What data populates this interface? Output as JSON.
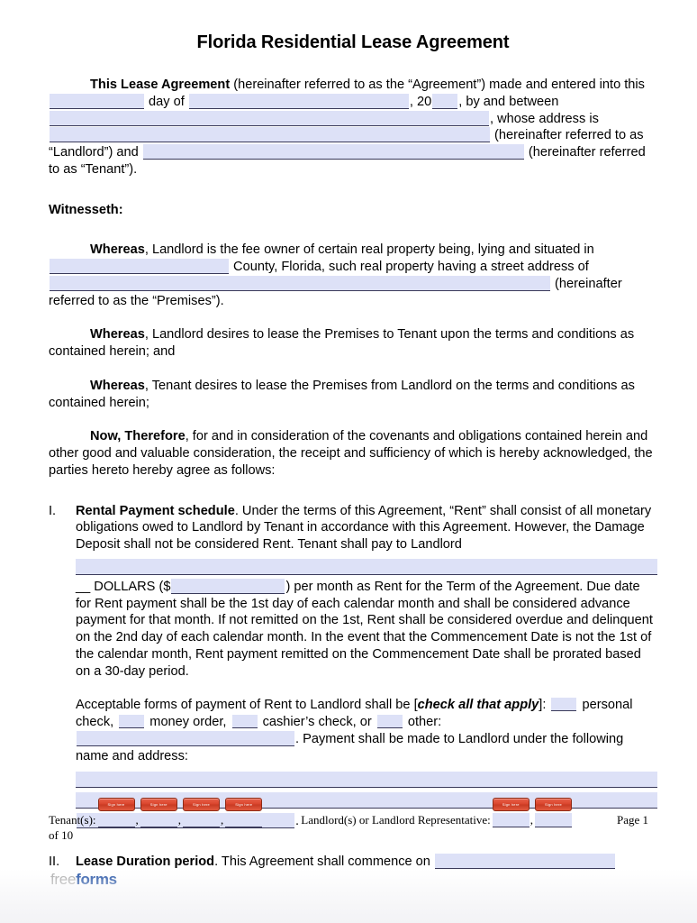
{
  "document": {
    "title": "Florida Residential Lease Agreement"
  },
  "intro": {
    "lead": "This Lease Agreement",
    "t1": " (hereinafter referred to as the “Agreement”) made and entered into this ",
    "t2": " day of ",
    "t3": ", 20",
    "t4": ", by and between ",
    "t5": ", whose address is ",
    "t6": " (hereinafter referred to as “Landlord”) and ",
    "t7": " (hereinafter referred to as “Tenant”)."
  },
  "witnesseth": {
    "heading": "Witnesseth:"
  },
  "whereas1": {
    "lead": "Whereas",
    "t1": ", Landlord is the fee owner of certain real property being, lying and situated in ",
    "t2": " County, Florida, such real property having a street address of ",
    "t3": " (hereinafter referred to as the “Premises”)."
  },
  "whereas2": {
    "lead": "Whereas",
    "t1": ", Landlord desires to lease the Premises to Tenant upon the terms and conditions as contained herein; and"
  },
  "whereas3": {
    "lead": "Whereas",
    "t1": ", Tenant desires to lease the Premises from Landlord on the terms and conditions as contained herein;"
  },
  "nowtherefore": {
    "lead": "Now, Therefore",
    "t1": ", for and in consideration of the covenants and obligations contained herein and other good and valuable consideration, the receipt and sufficiency of which is hereby acknowledged, the parties hereto hereby agree as follows:"
  },
  "section_one": {
    "numeral": "I.",
    "heading": "Rental Payment schedule",
    "t1": ".  Under the terms of this Agreement, “Rent” shall consist of all monetary obligations owed to Landlord by Tenant in accordance with this Agreement.  However, the Damage Deposit shall not be considered Rent.  Tenant shall pay to Landlord",
    "t2": "__ DOLLARS ($",
    "t3": ") per month as Rent for the Term of the Agreement. Due date for Rent payment shall be the 1st day of each calendar month and shall be considered advance payment for that month.  If not remitted on the 1st, Rent shall be considered overdue and delinquent on the 2nd day of each calendar month.  In the event that the Commencement Date is not the 1st of the calendar month, Rent payment remitted on the Commencement Date shall be prorated based on a 30-day period.",
    "payment_t1": "Acceptable forms of payment of Rent to Landlord shall be [",
    "payment_em": "check all that apply",
    "payment_t2": "]: ",
    "payment_t3": " personal check, ",
    "payment_t4": " money order, ",
    "payment_t5": " cashier’s check, or ",
    "payment_t6": " other: ",
    "payment_t7": ".  Payment shall be made to Landlord under the following name and address:",
    "payment_end": "."
  },
  "section_two": {
    "numeral": "II.",
    "heading": "Lease Duration period",
    "t1": ".  This Agreement shall commence on "
  },
  "footer": {
    "tenant_label": "Tenant(s):",
    "landlord_label": "Landlord(s) or Landlord Representative:",
    "page_label": "Page 1",
    "page_of": "of 10",
    "tenant_slots": 4,
    "landlord_slots": 2,
    "sign_button_label": "Sign here"
  },
  "logo": {
    "part1": "free",
    "part2": "forms"
  },
  "colors": {
    "form_field_fill": "#dde1f7",
    "form_field_underline": "#3a3a5a",
    "sign_button": "#d9442c",
    "logo_gray": "#a9a9a9",
    "logo_blue": "#1f4fa3"
  }
}
